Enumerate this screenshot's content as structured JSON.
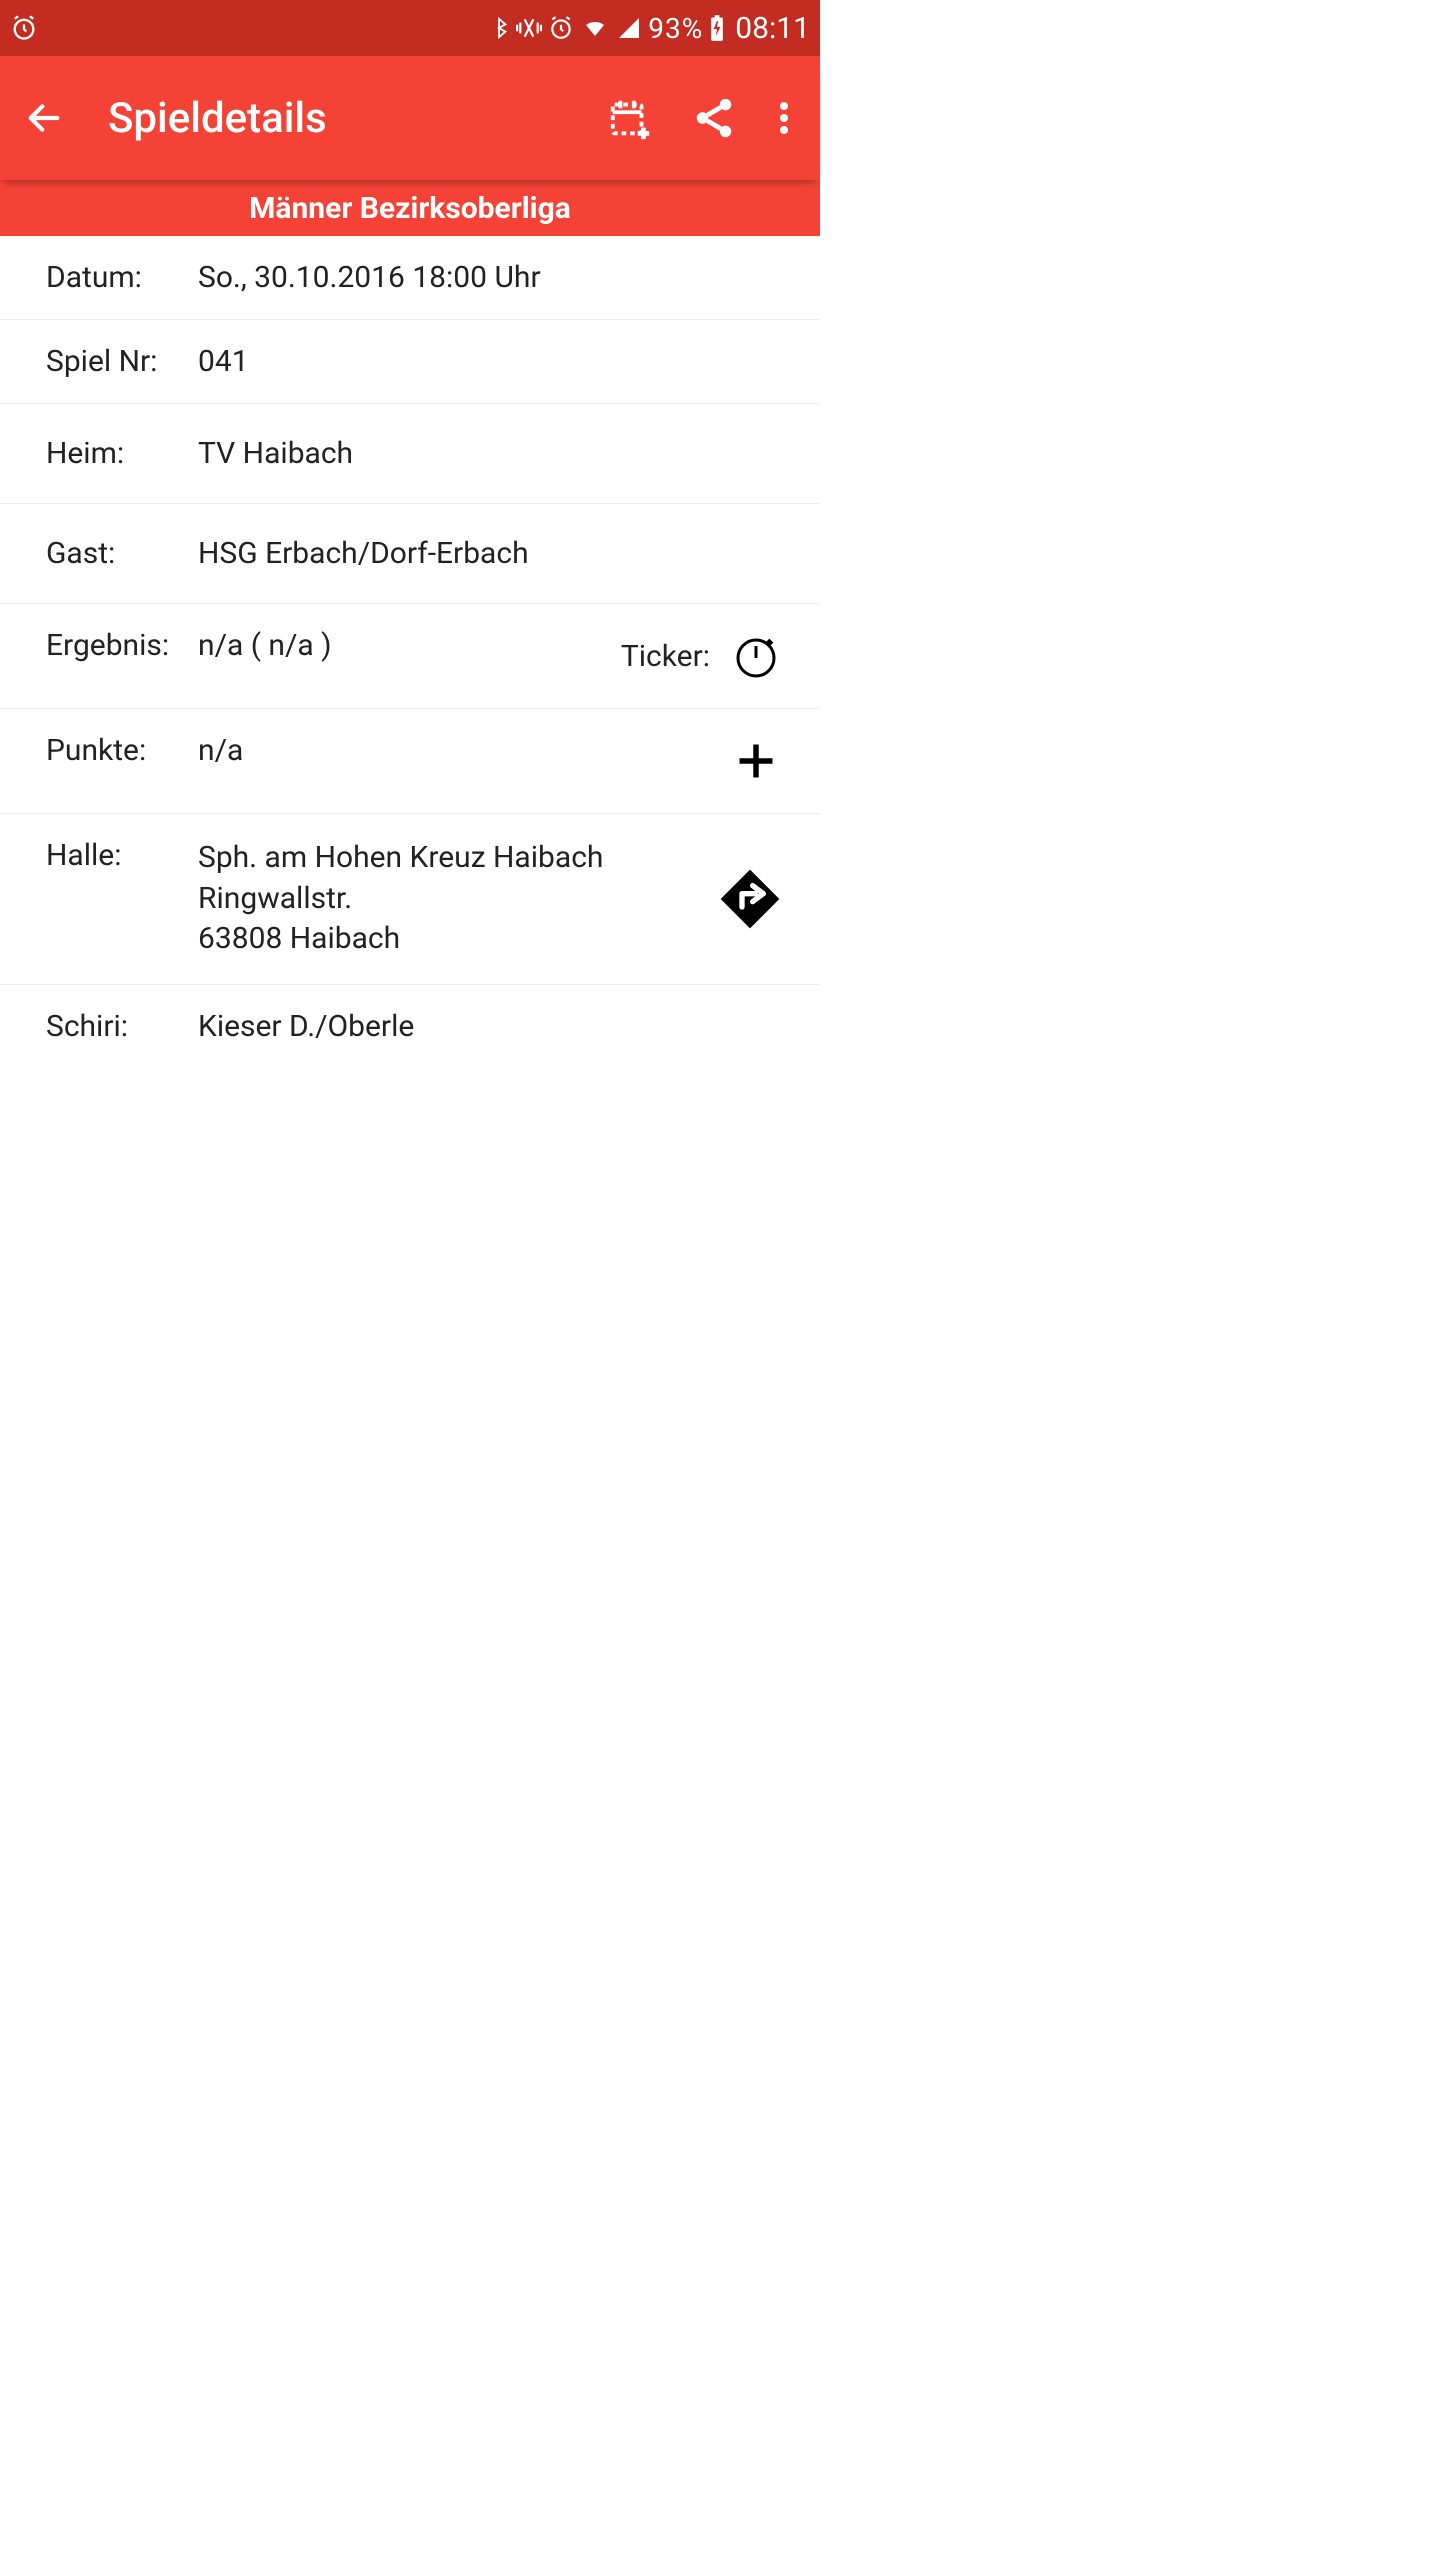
{
  "status": {
    "battery_pct": "93%",
    "time": "08:11"
  },
  "appbar": {
    "title": "Spieldetails"
  },
  "league": "Männer Bezirksoberliga",
  "rows": {
    "datum": {
      "label": "Datum:",
      "value": "So., 30.10.2016   18:00 Uhr"
    },
    "spielnr": {
      "label": "Spiel Nr:",
      "value": "041"
    },
    "heim": {
      "label": "Heim:",
      "value": "TV Haibach"
    },
    "gast": {
      "label": "Gast:",
      "value": "HSG Erbach/Dorf-Erbach"
    },
    "ergebnis": {
      "label": "Ergebnis:",
      "value": "n/a   ( n/a )",
      "ticker_label": "Ticker:"
    },
    "punkte": {
      "label": "Punkte:",
      "value": "n/a"
    },
    "halle": {
      "label": "Halle:",
      "value": "Sph. am Hohen Kreuz Haibach\nRingwallstr.\n63808 Haibach"
    },
    "schiri": {
      "label": "Schiri:",
      "value": "Kieser D./Oberle"
    }
  }
}
